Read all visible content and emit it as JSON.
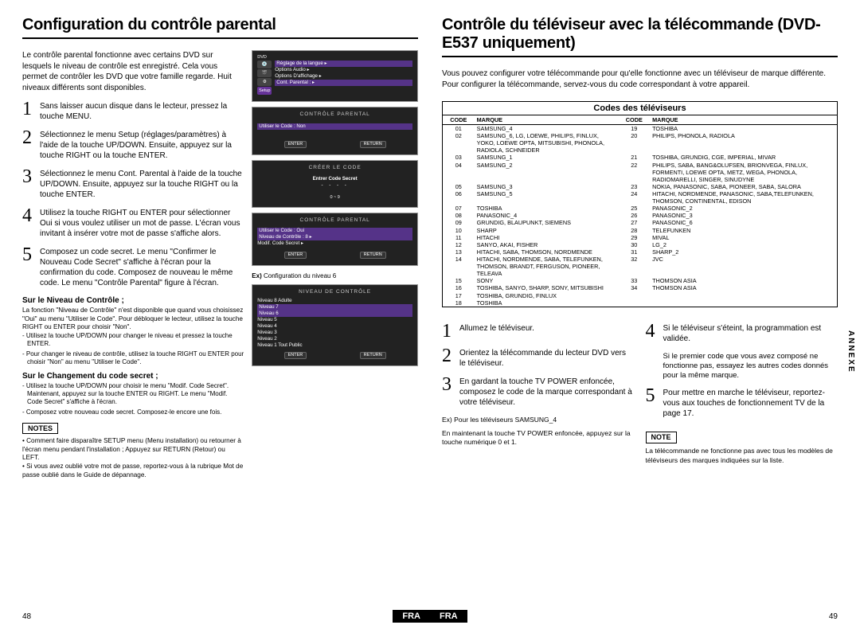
{
  "page_left": {
    "title": "Configuration du contrôle parental",
    "intro": "Le contrôle parental fonctionne avec certains DVD sur lesquels le niveau de contrôle est enregistré. Cela vous permet de contrôler les DVD que votre famille regarde. Huit niveaux différents sont disponibles.",
    "steps": [
      {
        "n": "1",
        "t": "Sans laisser aucun disque dans le lecteur, pressez la touche MENU."
      },
      {
        "n": "2",
        "t": "Sélectionnez le menu Setup (réglages/paramètres) à l'aide de la touche UP/DOWN. Ensuite, appuyez sur la touche RIGHT ou la touche ENTER."
      },
      {
        "n": "3",
        "t": "Sélectionnez le menu Cont. Parental à l'aide de la touche UP/DOWN. Ensuite, appuyez sur la touche RIGHT ou la touche ENTER."
      },
      {
        "n": "4",
        "t": "Utilisez la touche RIGHT ou ENTER pour sélectionner Oui si vous voulez utiliser un mot de passe. L'écran vous invitant à insérer votre mot de passe s'affiche alors."
      },
      {
        "n": "5",
        "t": "Composez un code secret. Le menu \"Confirmer le Nouveau Code Secret\" s'affiche à l'écran pour la confirmation du code. Composez de nouveau le même code. Le menu \"Contrôle Parental\" figure à l'écran."
      }
    ],
    "sub1_h": "Sur le Niveau de Contrôle ;",
    "sub1_body": "La fonction \"Niveau de Contrôle\" n'est disponible que quand vous choisissez \"Oui\" au menu \"Utiliser le Code\". Pour débloquer le lecteur, utilisez la touche RIGHT ou ENTER pour choisir \"Non\".",
    "sub1_b1": "- Utilisez la touche UP/DOWN pour changer le niveau et pressez la touche ENTER.",
    "sub1_b2": "- Pour changer le niveau de contrôle, utilisez la touche RIGHT ou ENTER pour choisir \"Non\" au menu \"Utiliser le Code\".",
    "sub2_h": "Sur le Changement du code secret ;",
    "sub2_b1": "- Utilisez la touche UP/DOWN pour choisir le menu \"Modif. Code Secret\". Maintenant, appuyez sur la touche ENTER ou RIGHT. Le menu \"Modif. Code Secret\" s'affiche à l'écran.",
    "sub2_b2": "- Composez votre nouveau code secret. Composez-le encore une fois.",
    "notes_label": "NOTES",
    "note1": "• Comment faire disparaître SETUP menu (Menu installation) ou retourner à l'écran menu pendant l'installation ; Appuyez sur RETURN (Retour) ou LEFT.",
    "note2": "• Si vous avez oublié votre mot de passe, reportez-vous à la rubrique Mot de passe oublié dans le Guide de dépannage.",
    "screens": {
      "s1": {
        "top": "DVD",
        "menu": [
          "Réglage de la langue ▸",
          "Options Audio ▸",
          "Options D'affichage ▸",
          "Cont. Parental : ▸"
        ]
      },
      "s2": {
        "hdr": "CONTRÔLE PARENTAL",
        "row": "Utiliser le Code       : Non"
      },
      "s3": {
        "hdr": "CRÉER LE CODE",
        "row": "Entrer Code Secret",
        "dash": "- - - -",
        "range": "0 ~ 9"
      },
      "s4": {
        "hdr": "CONTRÔLE PARENTAL",
        "r1": "Utiliser le Code     : Oui",
        "r2": "Niveau de Contrôle  : 8       ▸",
        "r3": "Modif. Code Secret             ▸"
      },
      "s5": {
        "hdr": "NIVEAU DE CONTRÔLE",
        "items": [
          "Niveau 8 Adulte",
          "Niveau 7",
          "Niveau 6",
          "Niveau 5",
          "Niveau 4",
          "Niveau 3",
          "Niveau 2",
          "Niveau 1 Tout Public"
        ]
      }
    },
    "caption_ex": "Ex) Configuration du niveau 6",
    "btn_enter": "ENTER",
    "btn_return": "RETURN",
    "page_num": "48",
    "fra": "FRA"
  },
  "page_right": {
    "title": "Contrôle du téléviseur avec la télécommande (DVD-E537 uniquement)",
    "intro": "Vous pouvez configurer votre télécommande pour qu'elle fonctionne avec un téléviseur de marque différente. Pour configurer la télécommande, servez-vous du code correspondant à votre appareil.",
    "table_title": "Codes des téléviseurs",
    "th_code": "CODE",
    "th_brand": "MARQUE",
    "left_rows": [
      {
        "c": "01",
        "b": "SAMSUNG_4"
      },
      {
        "c": "02",
        "b": "SAMSUNG_6, LG, LOEWE, PHILIPS, FINLUX, YOKO, LOEWE OPTA, MITSUBISHI, PHONOLA, RADIOLA, SCHNEIDER"
      },
      {
        "c": "03",
        "b": "SAMSUNG_1"
      },
      {
        "c": "04",
        "b": "SAMSUNG_2"
      },
      {
        "c": "05",
        "b": "SAMSUNG_3"
      },
      {
        "c": "06",
        "b": "SAMSUNG_5"
      },
      {
        "c": "07",
        "b": "TOSHIBA"
      },
      {
        "c": "08",
        "b": "PANASONIC_4"
      },
      {
        "c": "09",
        "b": "GRUNDIG, BLAUPUNKT, SIEMENS"
      },
      {
        "c": "10",
        "b": "SHARP"
      },
      {
        "c": "11",
        "b": "HITACHI"
      },
      {
        "c": "12",
        "b": "SANYO, AKAI, FISHER"
      },
      {
        "c": "13",
        "b": "HITACHI, SABA, THOMSON, NORDMENDE"
      },
      {
        "c": "14",
        "b": "HITACHI, NORDMENDE, SABA, TELEFUNKEN, THOMSON, BRANDT, FERGUSON, PIONEER, TELEAVA"
      },
      {
        "c": "15",
        "b": "SONY"
      },
      {
        "c": "16",
        "b": "TOSHIBA, SANYO, SHARP, SONY, MITSUBISHI"
      },
      {
        "c": "17",
        "b": "TOSHIBA, GRUNDIG, FINLUX"
      },
      {
        "c": "18",
        "b": "TOSHIBA"
      }
    ],
    "right_rows": [
      {
        "c": "19",
        "b": "TOSHIBA"
      },
      {
        "c": "20",
        "b": "PHILIPS, PHONOLA, RADIOLA"
      },
      {
        "c": "21",
        "b": "TOSHIBA, GRUNDIG, CGE, IMPERIAL, MIVAR"
      },
      {
        "c": "22",
        "b": "PHILIPS, SABA, BANG&OLUFSEN, BRIONVEGA, FINLUX, FORMENTI, LOEWE OPTA, METZ, WEGA, PHONOLA, RADIOMARELLI, SINGER, SINUDYNE"
      },
      {
        "c": "23",
        "b": "NOKIA, PANASONIC, SABA, PIONEER, SABA, SALORA"
      },
      {
        "c": "24",
        "b": "HITACHI, NORDMENDE, PANASONIC, SABA,TELEFUNKEN, THOMSON, CONTINENTAL, EDISON"
      },
      {
        "c": "25",
        "b": "PANASONIC_2"
      },
      {
        "c": "26",
        "b": "PANASONIC_3"
      },
      {
        "c": "27",
        "b": "PANASONIC_6"
      },
      {
        "c": "28",
        "b": "TELEFUNKEN"
      },
      {
        "c": "29",
        "b": "MIVAL"
      },
      {
        "c": "30",
        "b": "LG_2"
      },
      {
        "c": "31",
        "b": "SHARP_2"
      },
      {
        "c": "32",
        "b": "JVC"
      },
      {
        "c": "33",
        "b": "THOMSON ASIA"
      },
      {
        "c": "34",
        "b": "THOMSON ASIA"
      }
    ],
    "stepsA": [
      {
        "n": "1",
        "t": "Allumez le téléviseur."
      },
      {
        "n": "2",
        "t": "Orientez la télécommande du lecteur DVD vers le téléviseur."
      },
      {
        "n": "3",
        "t": "En gardant la touche TV POWER enfoncée, composez le code de la marque correspondant à votre téléviseur."
      }
    ],
    "ex_line": "Ex) Pour les téléviseurs SAMSUNG_4",
    "ex_body": "En maintenant la touche TV POWER enfoncée, appuyez sur la touche numérique 0 et 1.",
    "stepsB": [
      {
        "n": "4",
        "t": "Si le téléviseur s'éteint, la programmation est validée.",
        "extra": "Si le premier code que vous avez composé ne fonctionne pas, essayez les autres codes donnés pour la même marque."
      },
      {
        "n": "5",
        "t": "Pour mettre en marche le téléviseur, reportez-vous aux touches de fonctionnement TV de la page 17."
      }
    ],
    "note_label": "NOTE",
    "note_body": "La télécommande ne fonctionne pas avec tous les modèles de téléviseurs des marques indiquées sur la liste.",
    "annexe": "ANNEXE",
    "page_num": "49",
    "fra": "FRA"
  }
}
